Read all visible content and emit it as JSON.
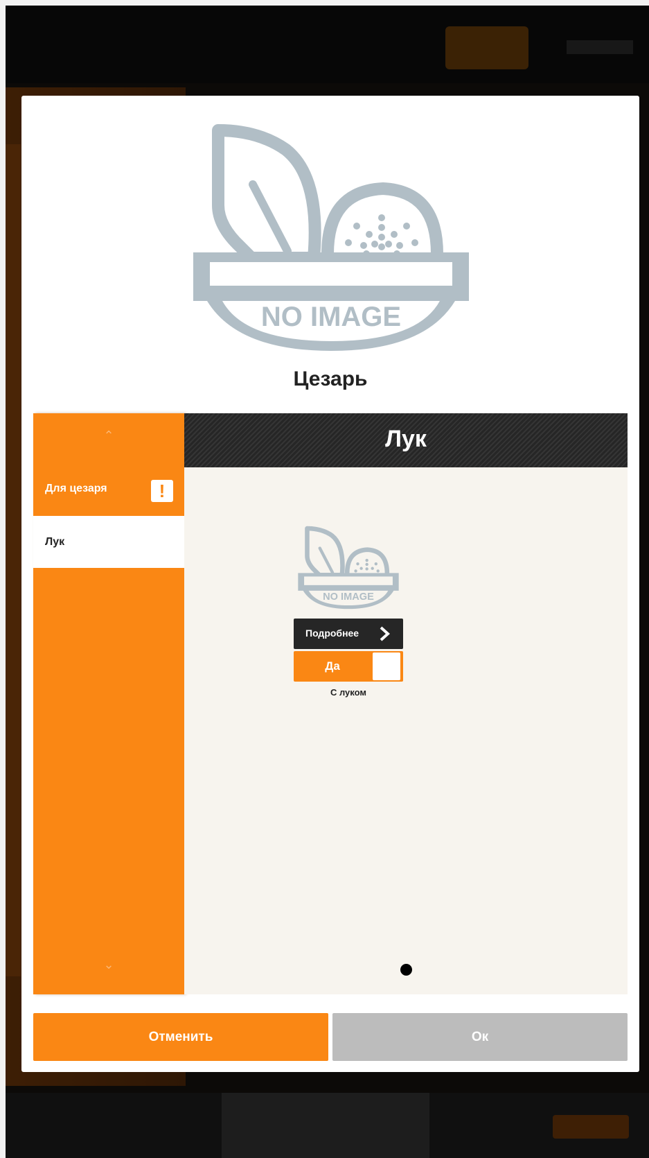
{
  "dialog": {
    "product_title": "Цезарь",
    "image_placeholder": "NO IMAGE"
  },
  "sidebar": {
    "items": [
      {
        "label": "Для цезаря",
        "active": true,
        "alert": "!"
      },
      {
        "label": "Лук",
        "active": false
      }
    ]
  },
  "content": {
    "header": "Лук",
    "option": {
      "image_placeholder": "NO IMAGE",
      "details_label": "Подробнее",
      "toggle_label": "Да",
      "caption": "С луком"
    }
  },
  "footer": {
    "cancel_label": "Отменить",
    "ok_label": "Ок"
  },
  "colors": {
    "accent": "#fa8714",
    "dark": "#262626",
    "disabled": "#bcbcbc",
    "placeholder_gray": "#b1bec6",
    "content_bg": "#f7f4ee"
  }
}
